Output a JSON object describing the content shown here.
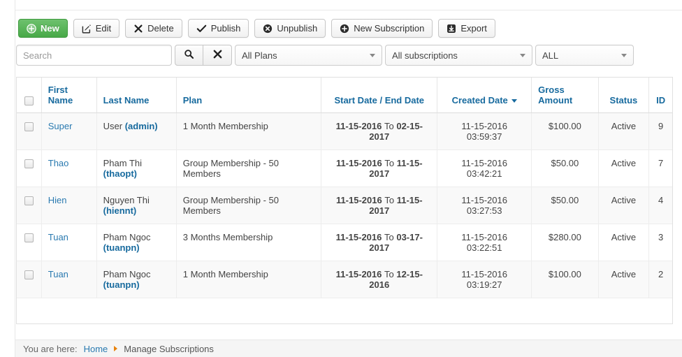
{
  "toolbar": {
    "buttons": [
      {
        "label": "New",
        "icon": "plus-circle-icon",
        "style": "primary"
      },
      {
        "label": "Edit",
        "icon": "pencil-square-icon",
        "style": "default"
      },
      {
        "label": "Delete",
        "icon": "x-mark-icon",
        "style": "default"
      },
      {
        "label": "Publish",
        "icon": "check-icon",
        "style": "default"
      },
      {
        "label": "Unpublish",
        "icon": "x-circle-icon",
        "style": "default"
      },
      {
        "label": "New Subscription",
        "icon": "plus-circle-icon",
        "style": "default"
      },
      {
        "label": "Export",
        "icon": "download-box-icon",
        "style": "default"
      }
    ]
  },
  "filters": {
    "search": {
      "value": "",
      "placeholder": "Search"
    },
    "search_button_icon": "magnifier-icon",
    "clear_button_icon": "x-mark-icon",
    "plan_select": {
      "value": "All Plans"
    },
    "subscription_select": {
      "value": "All subscriptions"
    },
    "status_select": {
      "value": "ALL"
    }
  },
  "table": {
    "headers": {
      "first_name": "First Name",
      "last_name": "Last Name",
      "plan": "Plan",
      "start_end": "Start Date / End Date",
      "created": "Created Date",
      "gross": "Gross Amount",
      "status": "Status",
      "id": "ID"
    },
    "sorted_column": "Created Date",
    "sort_direction": "desc",
    "rows": [
      {
        "first_name": "Super",
        "last_name": "User",
        "username": "(admin)",
        "plan": "1 Month Membership",
        "start_date": "11-15-2016",
        "date_join": "To",
        "end_date": "02-15-2017",
        "created_date": "11-15-2016",
        "created_time": "03:59:37",
        "gross_amount": "$100.00",
        "status": "Active",
        "id": "9"
      },
      {
        "first_name": "Thao",
        "last_name": "Pham Thi",
        "username": "(thaopt)",
        "plan": "Group Membership - 50 Members",
        "start_date": "11-15-2016",
        "date_join": "To",
        "end_date": "11-15-2017",
        "created_date": "11-15-2016",
        "created_time": "03:42:21",
        "gross_amount": "$50.00",
        "status": "Active",
        "id": "7"
      },
      {
        "first_name": "Hien",
        "last_name": "Nguyen Thi",
        "username": "(hiennt)",
        "plan": "Group Membership - 50 Members",
        "start_date": "11-15-2016",
        "date_join": "To",
        "end_date": "11-15-2017",
        "created_date": "11-15-2016",
        "created_time": "03:27:53",
        "gross_amount": "$50.00",
        "status": "Active",
        "id": "4"
      },
      {
        "first_name": "Tuan",
        "last_name": "Pham Ngoc",
        "username": "(tuanpn)",
        "plan": "3 Months Membership",
        "start_date": "11-15-2016",
        "date_join": "To",
        "end_date": "03-17-2017",
        "created_date": "11-15-2016",
        "created_time": "03:22:51",
        "gross_amount": "$280.00",
        "status": "Active",
        "id": "3"
      },
      {
        "first_name": "Tuan",
        "last_name": "Pham Ngoc",
        "username": "(tuanpn)",
        "plan": "1 Month Membership",
        "start_date": "11-15-2016",
        "date_join": "To",
        "end_date": "12-15-2016",
        "created_date": "11-15-2016",
        "created_time": "03:19:27",
        "gross_amount": "$100.00",
        "status": "Active",
        "id": "2"
      }
    ]
  },
  "breadcrumb": {
    "label": "You are here:",
    "home": "Home",
    "current": "Manage Subscriptions"
  },
  "colors": {
    "primary_green": "#48a948",
    "link_blue": "#2a7ab0",
    "header_blue": "#176a9e",
    "crumb_arrow_orange": "#e8820c"
  }
}
